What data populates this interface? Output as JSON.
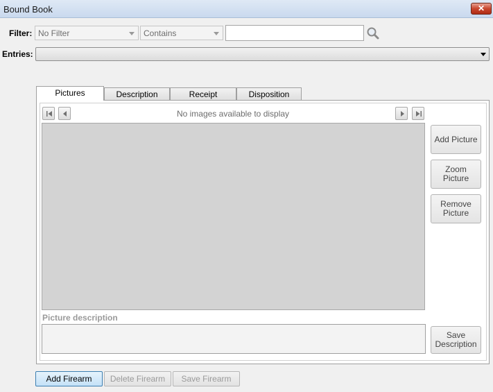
{
  "window": {
    "title": "Bound Book",
    "close_label": "✕"
  },
  "filter": {
    "label": "Filter:",
    "field_value": "No Filter",
    "operator_value": "Contains",
    "search_value": ""
  },
  "entries": {
    "label": "Entries:",
    "value": ""
  },
  "tabs": [
    {
      "label": "Pictures",
      "active": true
    },
    {
      "label": "Description",
      "active": false
    },
    {
      "label": "Receipt",
      "active": false
    },
    {
      "label": "Disposition",
      "active": false
    }
  ],
  "pictures": {
    "status_text": "No images available to display",
    "add_picture_label": "Add Picture",
    "zoom_picture_label": "Zoom\nPicture",
    "remove_picture_label": "Remove\nPicture",
    "description_label": "Picture description",
    "description_value": "",
    "save_description_label": "Save\nDescription"
  },
  "bottom": {
    "add_label": "Add Firearm",
    "delete_label": "Delete Firearm",
    "save_label": "Save Firearm"
  },
  "icons": {
    "first": "first-page-icon",
    "prev": "previous-icon",
    "next": "next-icon",
    "last": "last-page-icon",
    "search": "search-icon"
  }
}
